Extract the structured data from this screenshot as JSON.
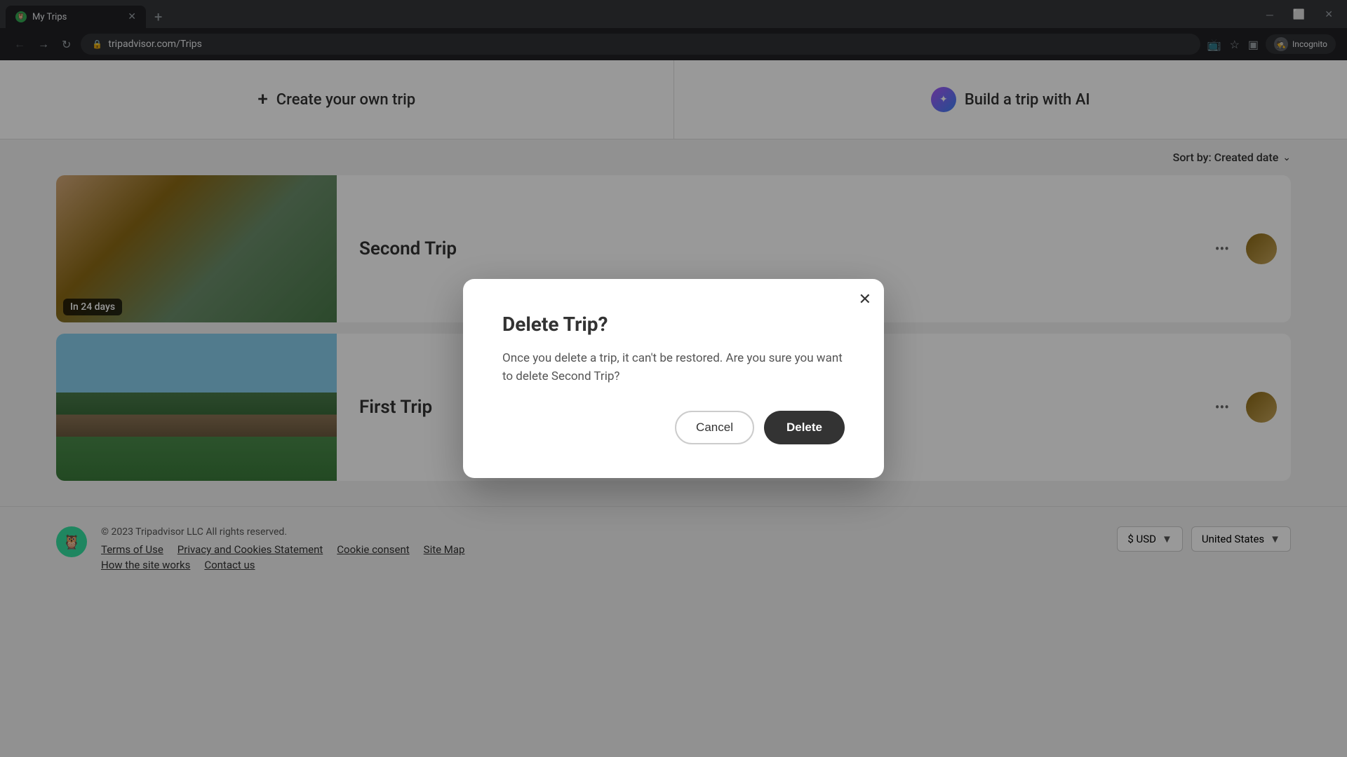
{
  "browser": {
    "tab_title": "My Trips",
    "tab_favicon": "🦉",
    "url": "tripadvisor.com/Trips",
    "incognito_label": "Incognito"
  },
  "action_bar": {
    "create_trip_label": "Create your own trip",
    "build_ai_label": "Build a trip with AI"
  },
  "sort": {
    "label": "Sort by: Created date",
    "icon": "chevron-down"
  },
  "trips": [
    {
      "name": "Second Trip",
      "badge": "In 24 days",
      "image_type": "arch"
    },
    {
      "name": "First Trip",
      "badge": null,
      "image_type": "monument"
    }
  ],
  "modal": {
    "title": "Delete Trip?",
    "body": "Once you delete a trip, it can't be restored. Are you sure you want to delete Second Trip?",
    "cancel_label": "Cancel",
    "delete_label": "Delete"
  },
  "footer": {
    "copyright": "© 2023 Tripadvisor LLC All rights reserved.",
    "links": [
      "Terms of Use",
      "Privacy and Cookies Statement",
      "Cookie consent",
      "Site Map"
    ],
    "links2": [
      "How the site works",
      "Contact us"
    ],
    "currency": "$ USD",
    "country": "United States"
  }
}
